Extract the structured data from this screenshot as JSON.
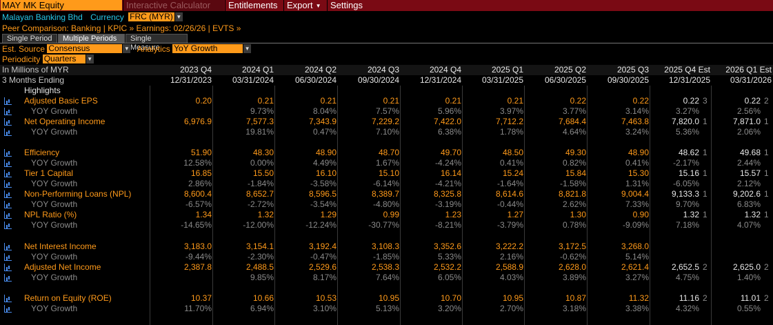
{
  "top": {
    "ticker": "MAY MK Equity",
    "menus": [
      "Interactive Calculator",
      "Entitlements",
      "Export",
      "Settings"
    ]
  },
  "info": {
    "company": "Malayan Banking Bhd",
    "currency_label": "Currency",
    "currency_value": "FRC (MYR)",
    "peer_line": "Peer Comparison: Banking | KPIC »  Earnings: 02/26/26 | EVTS »"
  },
  "tabs": [
    "Single Period",
    "Multiple Periods",
    "Single Measure"
  ],
  "controls": {
    "est_source_label": "Est. Source",
    "est_source_value": "Consensus",
    "analytics_label": "Analytics",
    "analytics_value": "YoY Growth",
    "periodicity_label": "Periodicity",
    "periodicity_value": "Quarters"
  },
  "table": {
    "units": "In Millions of MYR",
    "ending": "3 Months Ending",
    "columns": [
      {
        "period": "2023 Q4",
        "date": "12/31/2023"
      },
      {
        "period": "2024 Q1",
        "date": "03/31/2024"
      },
      {
        "period": "2024 Q2",
        "date": "06/30/2024"
      },
      {
        "period": "2024 Q3",
        "date": "09/30/2024"
      },
      {
        "period": "2024 Q4",
        "date": "12/31/2024"
      },
      {
        "period": "2025 Q1",
        "date": "03/31/2025"
      },
      {
        "period": "2025 Q2",
        "date": "06/30/2025"
      },
      {
        "period": "2025 Q3",
        "date": "09/30/2025"
      },
      {
        "period": "2025 Q4 Est",
        "date": "12/31/2025"
      },
      {
        "period": "2026 Q1 Est",
        "date": "03/31/2026"
      }
    ],
    "highlights": "Highlights",
    "metrics": [
      {
        "name": "Adjusted Basic EPS",
        "values": [
          "0.20",
          "0.21",
          "0.21",
          "0.21",
          "0.21",
          "0.21",
          "0.22",
          "0.22",
          "0.22",
          "0.22"
        ],
        "counts": [
          "3",
          "2"
        ],
        "growth": [
          "",
          "9.73%",
          "8.04%",
          "7.57%",
          "5.96%",
          "3.97%",
          "3.77%",
          "3.14%",
          "3.27%",
          "2.56%"
        ]
      },
      {
        "name": "Net Operating Income",
        "values": [
          "6,976.9",
          "7,577.3",
          "7,343.9",
          "7,229.2",
          "7,422.0",
          "7,712.2",
          "7,684.4",
          "7,463.8",
          "7,820.0",
          "7,871.0"
        ],
        "counts": [
          "1",
          "1"
        ],
        "growth": [
          "",
          "19.81%",
          "0.47%",
          "7.10%",
          "6.38%",
          "1.78%",
          "4.64%",
          "3.24%",
          "5.36%",
          "2.06%"
        ]
      },
      {
        "name": "Efficiency",
        "values": [
          "51.90",
          "48.30",
          "48.90",
          "48.70",
          "49.70",
          "48.50",
          "49.30",
          "48.90",
          "48.62",
          "49.68"
        ],
        "counts": [
          "1",
          "1"
        ],
        "growth": [
          "12.58%",
          "0.00%",
          "4.49%",
          "1.67%",
          "-4.24%",
          "0.41%",
          "0.82%",
          "0.41%",
          "-2.17%",
          "2.44%"
        ]
      },
      {
        "name": "Tier 1 Capital",
        "values": [
          "16.85",
          "15.50",
          "16.10",
          "15.10",
          "16.14",
          "15.24",
          "15.84",
          "15.30",
          "15.16",
          "15.57"
        ],
        "counts": [
          "1",
          "1"
        ],
        "growth": [
          "2.86%",
          "-1.84%",
          "-3.58%",
          "-6.14%",
          "-4.21%",
          "-1.64%",
          "-1.58%",
          "1.31%",
          "-6.05%",
          "2.12%"
        ]
      },
      {
        "name": "Non-Performing Loans (NPL)",
        "values": [
          "8,600.4",
          "8,652.7",
          "8,596.5",
          "8,389.7",
          "8,325.8",
          "8,614.6",
          "8,821.8",
          "9,004.4",
          "9,133.3",
          "9,202.6"
        ],
        "counts": [
          "1",
          "1"
        ],
        "growth": [
          "-6.57%",
          "-2.72%",
          "-3.54%",
          "-4.80%",
          "-3.19%",
          "-0.44%",
          "2.62%",
          "7.33%",
          "9.70%",
          "6.83%"
        ]
      },
      {
        "name": "NPL Ratio (%)",
        "values": [
          "1.34",
          "1.32",
          "1.29",
          "0.99",
          "1.23",
          "1.27",
          "1.30",
          "0.90",
          "1.32",
          "1.32"
        ],
        "counts": [
          "1",
          "1"
        ],
        "growth": [
          "-14.65%",
          "-12.00%",
          "-12.24%",
          "-30.77%",
          "-8.21%",
          "-3.79%",
          "0.78%",
          "-9.09%",
          "7.18%",
          "4.07%"
        ]
      },
      {
        "name": "Net Interest Income",
        "values": [
          "3,183.0",
          "3,154.1",
          "3,192.4",
          "3,108.3",
          "3,352.6",
          "3,222.2",
          "3,172.5",
          "3,268.0",
          "",
          ""
        ],
        "counts": [
          "",
          ""
        ],
        "growth": [
          "-9.44%",
          "-2.30%",
          "-0.47%",
          "-1.85%",
          "5.33%",
          "2.16%",
          "-0.62%",
          "5.14%",
          "",
          ""
        ]
      },
      {
        "name": "Adjusted Net Income",
        "values": [
          "2,387.8",
          "2,488.5",
          "2,529.6",
          "2,538.3",
          "2,532.2",
          "2,588.9",
          "2,628.0",
          "2,621.4",
          "2,652.5",
          "2,625.0"
        ],
        "counts": [
          "2",
          "2"
        ],
        "growth": [
          "",
          "9.85%",
          "8.17%",
          "7.64%",
          "6.05%",
          "4.03%",
          "3.89%",
          "3.27%",
          "4.75%",
          "1.40%"
        ]
      },
      {
        "name": "Return on Equity (ROE)",
        "values": [
          "10.37",
          "10.66",
          "10.53",
          "10.95",
          "10.70",
          "10.95",
          "10.87",
          "11.32",
          "11.16",
          "11.01"
        ],
        "counts": [
          "2",
          "2"
        ],
        "growth": [
          "11.70%",
          "6.94%",
          "3.10%",
          "5.13%",
          "3.20%",
          "2.70%",
          "3.18%",
          "3.38%",
          "4.32%",
          "0.55%"
        ]
      }
    ]
  }
}
